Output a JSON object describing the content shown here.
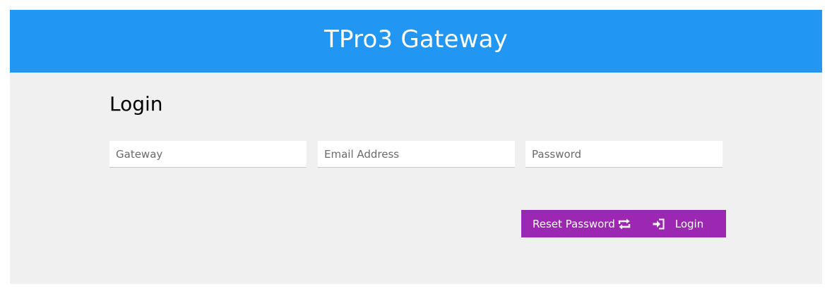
{
  "header": {
    "title": "TPro3 Gateway"
  },
  "login": {
    "heading": "Login",
    "fields": {
      "gateway_placeholder": "Gateway",
      "email_placeholder": "Email Address",
      "password_placeholder": "Password"
    },
    "actions": {
      "reset_label": "Reset Password",
      "reset_icon": "refresh-icon",
      "login_label": "Login",
      "login_icon": "sign-in-icon"
    }
  },
  "colors": {
    "header_bg": "#2196f3",
    "page_bg": "#f0f0f0",
    "button_bg": "#9c27b0"
  }
}
